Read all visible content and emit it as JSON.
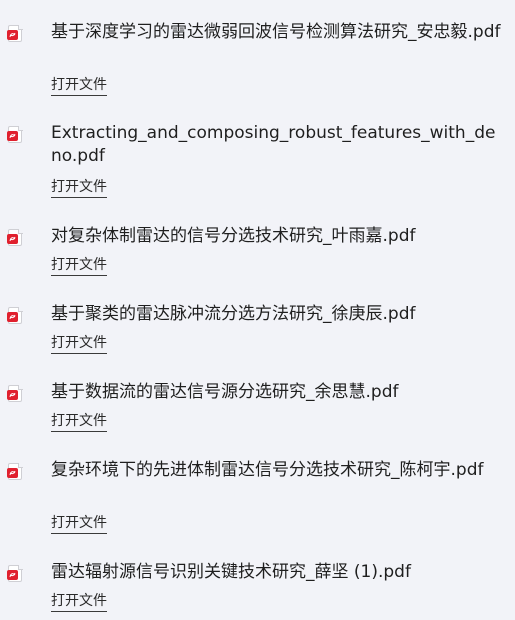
{
  "files": [
    {
      "icon": "pdf-file-icon",
      "name": "基于深度学习的雷达微弱回波信号检测算法研究_安忠毅.pdf",
      "action": "打开文件"
    },
    {
      "icon": "pdf-file-icon",
      "name": "Extracting_and_composing_robust_features_with_deno.pdf",
      "action": "打开文件"
    },
    {
      "icon": "pdf-file-icon",
      "name": "对复杂体制雷达的信号分选技术研究_叶雨嘉.pdf",
      "action": "打开文件"
    },
    {
      "icon": "pdf-file-icon",
      "name": "基于聚类的雷达脉冲流分选方法研究_徐庚辰.pdf",
      "action": "打开文件"
    },
    {
      "icon": "pdf-file-icon",
      "name": "基于数据流的雷达信号源分选研究_余思慧.pdf",
      "action": "打开文件"
    },
    {
      "icon": "pdf-file-icon",
      "name": "复杂环境下的先进体制雷达信号分选技术研究_陈柯宇.pdf",
      "action": "打开文件"
    },
    {
      "icon": "pdf-file-icon",
      "name": "雷达辐射源信号识别关键技术研究_薛坚 (1).pdf",
      "action": "打开文件"
    }
  ],
  "colors": {
    "background": "#f2f3f8",
    "pdf_badge": "#e0202e",
    "text": "#1f1f1f"
  }
}
